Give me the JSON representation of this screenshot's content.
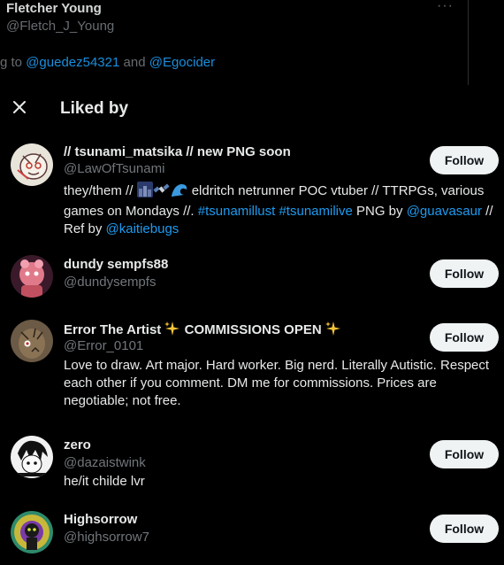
{
  "background_tweet": {
    "name": "Fletcher Young",
    "handle": "@Fletch_J_Young",
    "reply_prefix": "g to ",
    "reply_link_1": "@guedez54321",
    "reply_and": " and ",
    "reply_link_2": "@Egocider"
  },
  "modal": {
    "title": "Liked by"
  },
  "users": [
    {
      "name_prefix": "// tsunami_matsika // new PNG soon",
      "handle": "@LawOfTsunami",
      "follow_label": "Follow",
      "bio": {
        "t1": "they/them // ",
        "t2": " eldritch netrunner POC vtuber // TTRPGs, various games on Mondays //. ",
        "tag1": "#tsunamillust",
        "sp": " ",
        "tag2": "#tsunamilive",
        "t3": " PNG by ",
        "mention1": "@guavasaur",
        "t4": " // Ref by ",
        "mention2": "@kaitiebugs"
      }
    },
    {
      "name": "dundy sempfs88",
      "handle": "@dundysempfs",
      "follow_label": "Follow"
    },
    {
      "name": "Error The Artist",
      "name_suffix": "COMMISSIONS OPEN",
      "handle": "@Error_0101",
      "follow_label": "Follow",
      "bio": "Love to draw. Art major. Hard worker. Big nerd. Literally Autistic. Respect each other if you comment. DM me for commissions. Prices are negotiable; not free."
    },
    {
      "name": "zero",
      "handle": "@dazaistwink",
      "follow_label": "Follow",
      "bio": "he/it childe lvr"
    },
    {
      "name": "Highsorrow",
      "handle": "@highsorrow7",
      "follow_label": "Follow"
    }
  ],
  "icons": {
    "close": "close-icon",
    "more": "more-icon",
    "sparkles": "sparkles-emoji",
    "bio_emojis": [
      "city-night-emoji",
      "satellite-emoji",
      "wave-emoji"
    ]
  },
  "colors": {
    "background": "#000000",
    "text": "#e7e9ea",
    "secondary": "#71767b",
    "link": "#1d9bf0",
    "button_bg": "#eff3f4",
    "button_text": "#0f1419"
  }
}
